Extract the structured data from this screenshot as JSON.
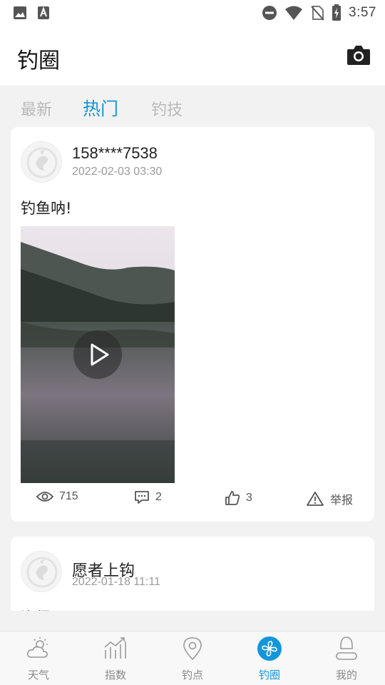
{
  "status_bar": {
    "time": "3:57",
    "left_icons": [
      "image-icon",
      "a-icon"
    ],
    "right_icons": [
      "dnd-icon",
      "wifi-icon",
      "no-sim-icon",
      "battery-charging-icon"
    ]
  },
  "app_bar": {
    "title": "钓圈",
    "camera_icon": "camera-icon"
  },
  "tabs": [
    {
      "label": "最新",
      "active": false
    },
    {
      "label": "热门",
      "active": true
    },
    {
      "label": "钓技",
      "active": false
    }
  ],
  "posts": [
    {
      "username": "158****7538",
      "date": "2022-02-03 03:30",
      "text": "钓鱼呐!",
      "has_video": true,
      "views": "715",
      "comments": "2",
      "likes": "3",
      "report_label": "举报"
    },
    {
      "username": "愿者上钩",
      "date": "2022-01-18 11:11",
      "text": "渔得"
    }
  ],
  "bottom_nav": [
    {
      "label": "天气",
      "icon": "weather-icon",
      "active": false
    },
    {
      "label": "指数",
      "icon": "chart-icon",
      "active": false
    },
    {
      "label": "钓点",
      "icon": "location-pin-icon",
      "active": false
    },
    {
      "label": "钓圈",
      "icon": "pinwheel-icon",
      "active": true
    },
    {
      "label": "我的",
      "icon": "user-icon",
      "active": false
    }
  ],
  "colors": {
    "accent": "#1296db",
    "inactive_tab": "#b9b9b9",
    "background": "#f2f2f2"
  }
}
